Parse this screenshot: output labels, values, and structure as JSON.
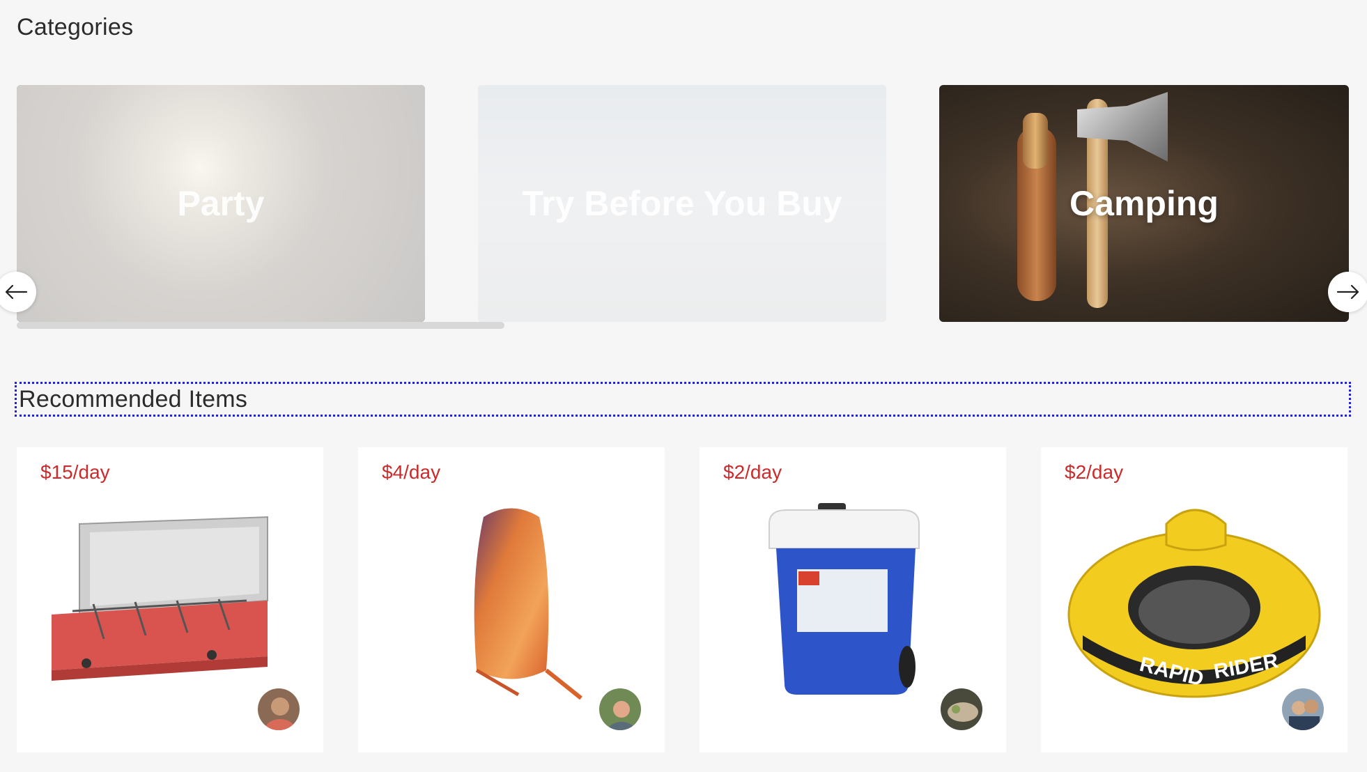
{
  "sections": {
    "categories_title": "Categories",
    "recommended_title": "Recommended Items"
  },
  "categories": [
    {
      "label": "Party",
      "state": "faded"
    },
    {
      "label": "Try Before You Buy",
      "state": "faded"
    },
    {
      "label": "Camping",
      "state": "active"
    }
  ],
  "carousel": {
    "prev_icon": "arrow-left-icon",
    "next_icon": "arrow-right-icon"
  },
  "items": [
    {
      "price": "$15/day",
      "product": "camping-stove",
      "owner_avatar": "owner-avatar"
    },
    {
      "price": "$4/day",
      "product": "sleeping-bag",
      "owner_avatar": "owner-avatar"
    },
    {
      "price": "$2/day",
      "product": "cooler",
      "owner_avatar": "owner-avatar"
    },
    {
      "price": "$2/day",
      "product": "inflatable-tube",
      "owner_avatar": "owner-avatar"
    }
  ],
  "colors": {
    "price": "#cc2b2b",
    "focus_outline": "#2222dd",
    "background": "#f6f6f6"
  }
}
